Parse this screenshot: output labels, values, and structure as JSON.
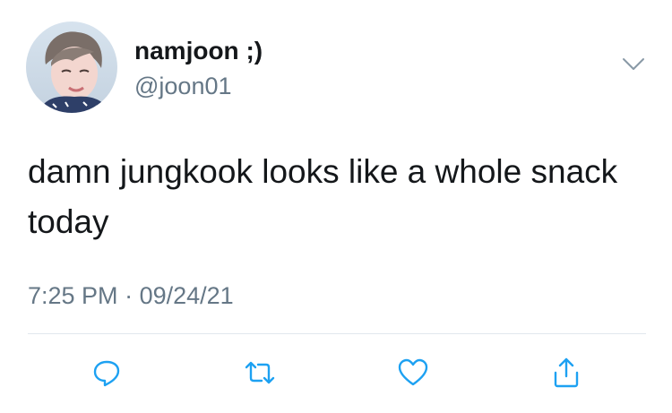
{
  "tweet": {
    "display_name": "namjoon ;)",
    "handle": "@joon01",
    "text": "damn jungkook looks like a whole snack today",
    "time": "7:25 PM",
    "separator": "·",
    "date": "09/24/21"
  },
  "icons": {
    "more": "chevron-down-icon",
    "reply": "reply-icon",
    "retweet": "retweet-icon",
    "like": "heart-icon",
    "share": "share-icon"
  },
  "colors": {
    "text": "#14171a",
    "secondary": "#657786",
    "icon": "#1da1f2",
    "divider": "#e1e8ed"
  }
}
